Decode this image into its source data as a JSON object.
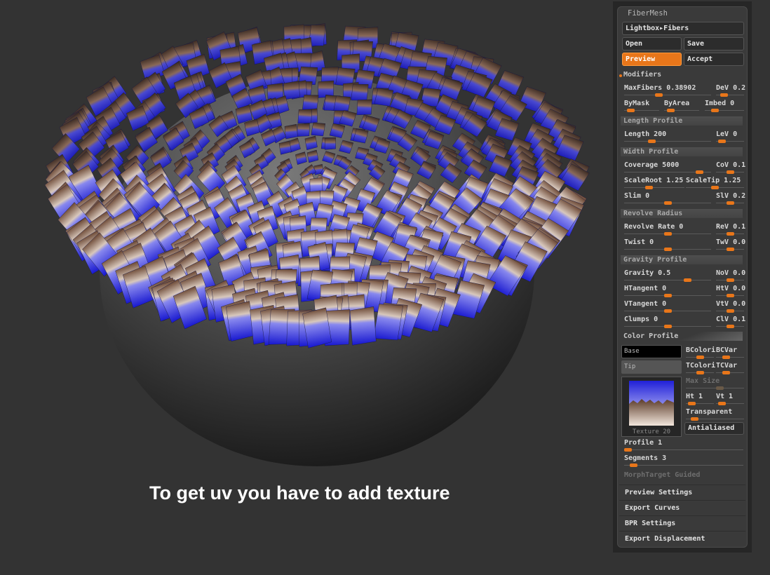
{
  "viewport": {
    "caption": "To get uv you have to add texture"
  },
  "panel": {
    "title": "FiberMesh",
    "lightbox_button": "Lightbox▸Fibers",
    "open_button": "Open",
    "save_button": "Save",
    "preview_button": "Preview",
    "accept_button": "Accept",
    "modifiers_label": "Modifiers",
    "sections": {
      "length_profile": "Length Profile",
      "width_profile": "Width Profile",
      "revolve_radius": "Revolve Radius",
      "gravity_profile": "Gravity Profile",
      "color_profile": "Color Profile"
    },
    "sliders": {
      "maxfibers": "MaxFibers 0.38902",
      "dev": "DeV 0.2",
      "bymask": "ByMask",
      "byarea": "ByArea",
      "imbed": "Imbed 0",
      "length": "Length 200",
      "lev": "LeV 0",
      "coverage": "Coverage 5000",
      "cov": "CoV 0.1",
      "scaleroot": "ScaleRoot 1.25",
      "scaletip": "ScaleTip 1.25",
      "slim": "Slim 0",
      "slv": "SlV 0.2",
      "revolve_rate": "Revolve Rate 0",
      "rev": "ReV 0.1",
      "twist": "Twist 0",
      "twv": "TwV 0.0",
      "gravity": "Gravity 0.5",
      "nov": "NoV 0.0",
      "htangent": "HTangent 0",
      "htv": "HtV 0.0",
      "vtangent": "VTangent 0",
      "vtv": "VtV 0.0",
      "clumps": "Clumps 0",
      "clv": "ClV 0.1",
      "bcolori": "BColori",
      "bcvar": "BCVar",
      "tcolori": "TColori",
      "tcvar": "TCVar",
      "max_size": "Max Size",
      "ht": "Ht 1",
      "vt": "Vt 1",
      "transparent": "Transparent",
      "profile": "Profile 1",
      "segments": "Segments 3"
    },
    "levels": {
      "maxfibers": 0.39,
      "dev": 0.2,
      "bymask": 0.1,
      "byarea": 0.1,
      "imbed": 0.2,
      "length": 0.3,
      "lev": 0.1,
      "coverage": 0.9,
      "cov": 0.5,
      "scaleroot": 0.4,
      "scaletip": 0.5,
      "slim": 0.5,
      "slv": 0.5,
      "revolve_rate": 0.5,
      "rev": 0.5,
      "twist": 0.5,
      "twv": 0.5,
      "gravity": 0.75,
      "nov": 0.5,
      "htangent": 0.5,
      "htv": 0.5,
      "vtangent": 0.5,
      "vtv": 0.5,
      "clumps": 0.5,
      "clv": 0.5,
      "bcolori": 0.5,
      "bcvar": 0.3,
      "tcolori": 0.5,
      "tcvar": 0.3,
      "max_size": 0.6,
      "ht": 0.1,
      "vt": 0.1,
      "transparent": 0.1,
      "profile": 0.0,
      "segments": 0.05
    },
    "base_swatch": "Base",
    "tip_swatch": "Tip",
    "texture_label": "Texture 20",
    "antialiased": "Antialiased",
    "morphtarget": "MorphTarget Guided",
    "menu": [
      "Preview Settings",
      "Export Curves",
      "BPR Settings",
      "Export Displacement"
    ]
  },
  "colors": {
    "accent": "#e8761a",
    "fiber_blue": "#2a2ad8",
    "fiber_brown": "#6a4632",
    "background": "#333333"
  }
}
